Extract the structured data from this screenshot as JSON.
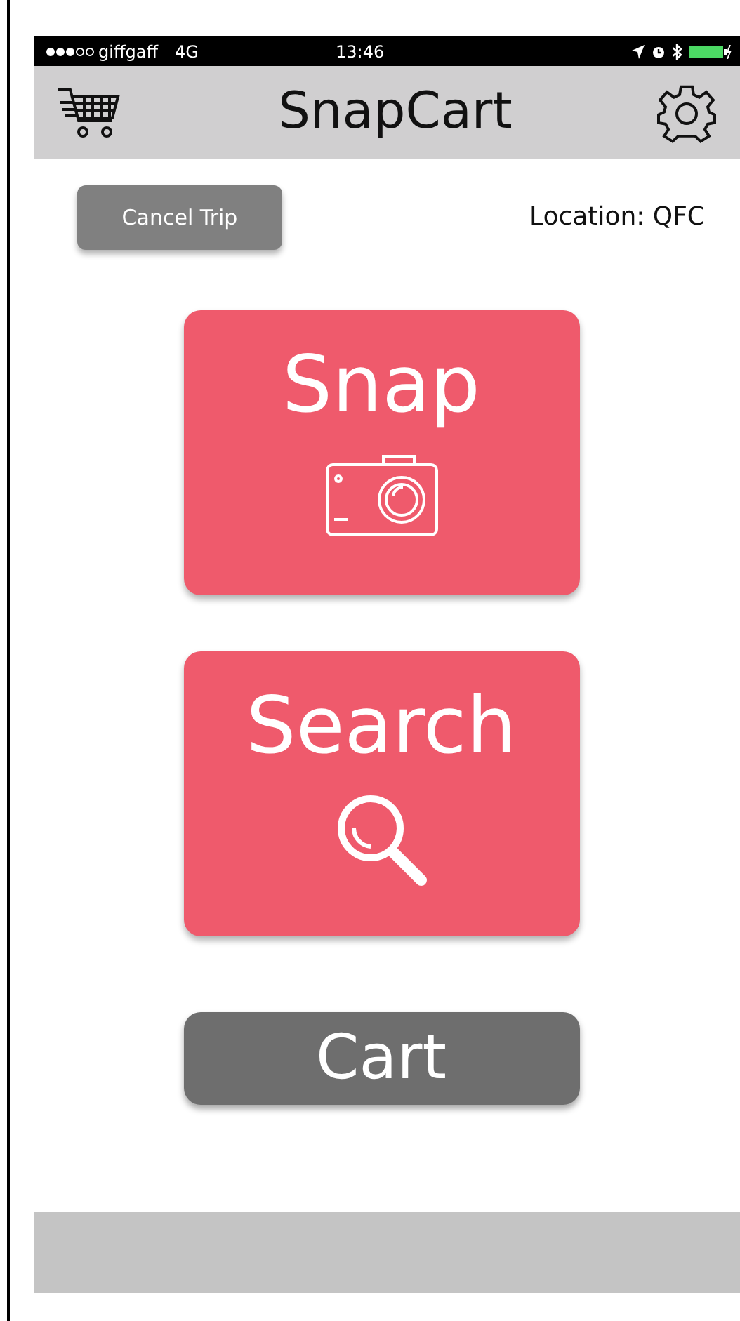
{
  "status_bar": {
    "carrier": "giffgaff",
    "network": "4G",
    "time": "13:46"
  },
  "header": {
    "title": "SnapCart"
  },
  "trip": {
    "cancel_button": "Cancel Trip",
    "location": "Location: QFC"
  },
  "actions": [
    {
      "label": "Snap",
      "kind": "camera"
    },
    {
      "label": "Search",
      "kind": "search"
    }
  ],
  "cart_button": "Cart"
}
